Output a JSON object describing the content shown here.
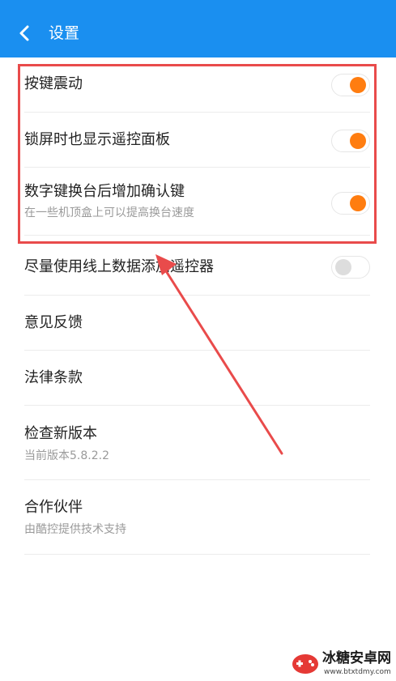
{
  "header": {
    "title": "设置",
    "back_icon": "chevron-left-icon"
  },
  "settings": [
    {
      "label": "按键震动",
      "toggle": true
    },
    {
      "label": "锁屏时也显示遥控面板",
      "toggle": true
    },
    {
      "label": "数字键换台后增加确认键",
      "sub": "在一些机顶盒上可以提高换台速度",
      "toggle": true
    },
    {
      "label": "尽量使用线上数据添加遥控器",
      "toggle": false
    },
    {
      "label": "意见反馈"
    },
    {
      "label": "法律条款"
    },
    {
      "label": "检查新版本",
      "sub": "当前版本5.8.2.2"
    },
    {
      "label": "合作伙伴",
      "sub": "由酷控提供技术支持"
    }
  ],
  "colors": {
    "header": "#1a8ff0",
    "toggle_on": "#ff7d10",
    "highlight": "#e94b4b"
  },
  "watermark": {
    "title": "冰糖安卓网",
    "url": "www.btxtdmy.com"
  }
}
